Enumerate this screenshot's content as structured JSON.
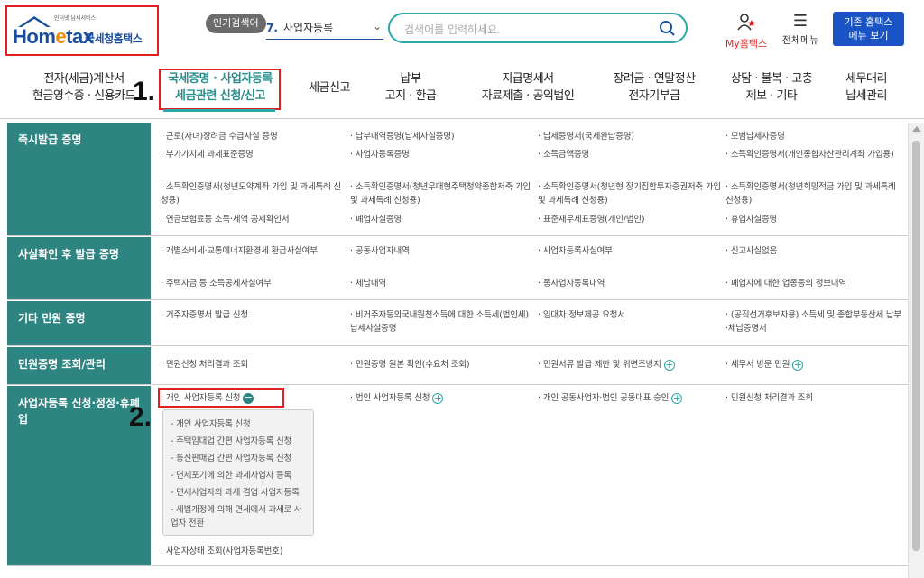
{
  "header": {
    "logo_small": "인터넷 납세서비스",
    "logo_main_a": "Hom",
    "logo_main_e": "e",
    "logo_main_b": "tax",
    "logo_kr": "국세청홈택스",
    "popular_badge": "인기검색어",
    "popular_num": "7.",
    "popular_text": "사업자등록",
    "search_placeholder": "검색어를 입력하세요.",
    "my_label": "My홈택스",
    "allmenu_label": "전체메뉴",
    "old_button": "기존 홈택스\n메뉴 보기"
  },
  "nav": [
    {
      "label": "전자(세금)계산서\n현금영수증 · 신용카드"
    },
    {
      "label": "국세증명 · 사업자등록\n세금관련 신청/신고"
    },
    {
      "label": "세금신고"
    },
    {
      "label": "납부\n고지 · 환급"
    },
    {
      "label": "지급명세서\n자료제출 · 공익법인"
    },
    {
      "label": "장려금 · 연말정산\n전자기부금"
    },
    {
      "label": "상담 · 불복 · 고충\n제보 · 기타"
    },
    {
      "label": "세무대리\n납세관리"
    }
  ],
  "steps": {
    "one": "1.",
    "two": "2."
  },
  "sections": [
    {
      "title": "즉시발급 증명",
      "cells": [
        "근로(자녀)장려금 수급사실 증명",
        "납부내역증명(납세사실증명)",
        "납세증명서(국세완납증명)",
        "모범납세자증명",
        "부가가치세 과세표준증명",
        "사업자등록증명",
        "소득금액증명",
        "소득확인증명서(개인종합자산관리계좌 가입용)",
        "소득확인증명서(청년도약계좌 가입 및 과세특례 신청용)",
        "소득확인증명서(청년우대형주택청약종합저축 가입 및 과세특례 신청용)",
        "소득확인증명서(청년형 장기집합투자증권저축 가입 및 과세특례 신청용)",
        "소득확인증명서(청년희망적금 가입 및 과세특례 신청용)",
        "연금보험료등 소득·세액 공제확인서",
        "폐업사실증명",
        "표준재무제표증명(개인/법인)",
        "휴업사실증명"
      ]
    },
    {
      "title": "사실확인 후 발급 증명",
      "cells": [
        "개별소비세·교통에너지환경세 환급사실여부",
        "공동사업자내역",
        "사업자등록사실여부",
        "신고사실없음",
        "주택자금 등 소득공제사실여부",
        "체납내역",
        "종사업자등록내역",
        "폐업자에 대한 업종등의 정보내역"
      ]
    },
    {
      "title": "기타 민원 증명",
      "cells": [
        "거주자증명서 발급 신청",
        "비거주자등의국내원천소득에 대한 소득세(법인세) 납세사실증명",
        "임대차 정보제공 요청서",
        "(공직선거후보자용) 소득세 및 종합부동산세 납부·체납증명서"
      ]
    },
    {
      "title": "민원증명 조회/관리",
      "cells": [
        "민원신청 처리결과 조회",
        "민원증명 원본 확인(수요처 조회)",
        "민원서류 발급 제한 및 위변조방지",
        "세무서 방문 민원"
      ]
    },
    {
      "title": "사업자등록 신청·정정·휴폐업",
      "cells": [
        "개인 사업자등록 신청",
        "법인 사업자등록 신청",
        "개인 공동사업자·법인 공동대표 승인",
        "민원신청 처리결과 조회",
        "사업자상태 조회(사업자등록번호)"
      ],
      "submenu": [
        "개인 사업자등록 신청",
        "주택임대업 간편 사업자등록 신청",
        "통신판매업 간편 사업자등록 신청",
        "면세포기에 의한 과세사업자 등록",
        "면세사업자의 과세 겸업 사업자등록",
        "세법개정에 의해 면세에서 과세로 사업자 전환"
      ]
    }
  ],
  "icons": {
    "plus": "+",
    "minus": "−"
  }
}
